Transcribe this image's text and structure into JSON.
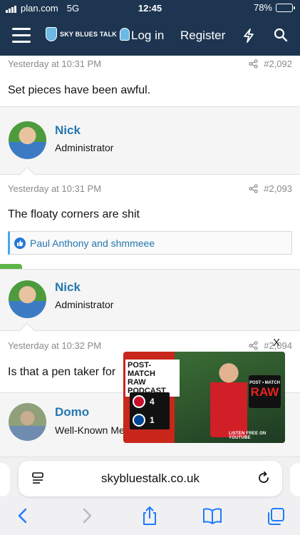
{
  "status_bar": {
    "carrier": "plan.com",
    "network": "5G",
    "time": "12:45",
    "battery": "78%",
    "battery_level": 0.78
  },
  "navbar": {
    "site_name": "SKY BLUES TALK",
    "login": "Log in",
    "register": "Register"
  },
  "posts": [
    {
      "timestamp": "Yesterday at 10:31 PM",
      "number": "#2,092",
      "text": "Set pieces have been awful."
    },
    {
      "username": "Nick",
      "user_title": "Administrator",
      "timestamp": "Yesterday at 10:31 PM",
      "number": "#2,093",
      "text": "The floaty corners are shit",
      "reactions": "Paul Anthony and shmmeee"
    },
    {
      "username": "Nick",
      "user_title": "Administrator",
      "timestamp": "Yesterday at 10:32 PM",
      "number": "#2,094",
      "text": "Is that a pen taker for"
    },
    {
      "username": "Domo",
      "user_title": "Well-Known Me"
    }
  ],
  "ad": {
    "title_line1": "POST-MATCH",
    "title_line2": "RAW PODCAST",
    "score_home": "4",
    "score_away": "1",
    "badge_top": "POST • MATCH",
    "badge_main": "RAW",
    "youtube_text": "LISTEN FREE ON YOUTUBE",
    "close": "X"
  },
  "browser": {
    "url": "skybluestalk.co.uk"
  },
  "colors": {
    "header": "#1d3550",
    "link": "#2577b1",
    "gear": "#5fb548",
    "ad_red": "#c9261c"
  }
}
